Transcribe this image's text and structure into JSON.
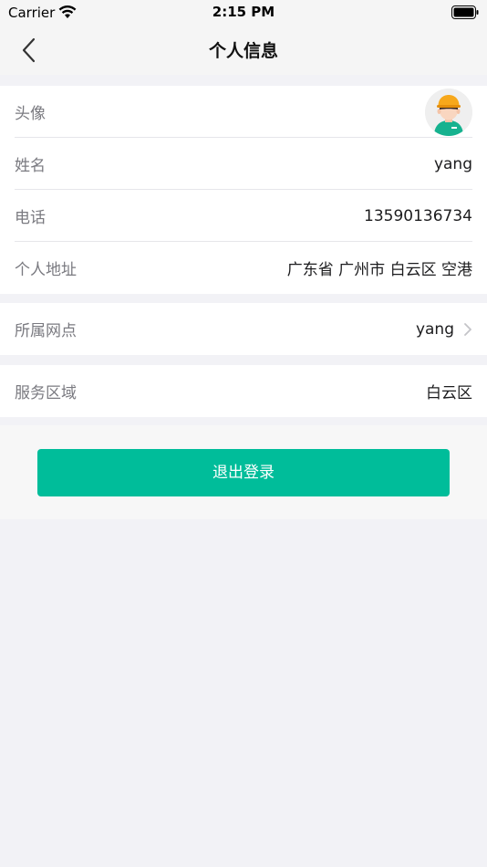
{
  "status_bar": {
    "carrier": "Carrier",
    "time": "2:15 PM"
  },
  "nav": {
    "title": "个人信息",
    "back_icon": "chevron-left-icon"
  },
  "profile": {
    "avatar_label": "头像",
    "name_label": "姓名",
    "name_value": "yang",
    "phone_label": "电话",
    "phone_value": "13590136734",
    "address_label": "个人地址",
    "address_value": "广东省 广州市 白云区 空港"
  },
  "outlet": {
    "label": "所属网点",
    "value": "yang"
  },
  "service": {
    "label": "服务区域",
    "value": "白云区"
  },
  "logout": {
    "label": "退出登录"
  },
  "colors": {
    "accent": "#00bd9a",
    "background": "#f2f2f6",
    "label_text": "#7a7a80"
  }
}
